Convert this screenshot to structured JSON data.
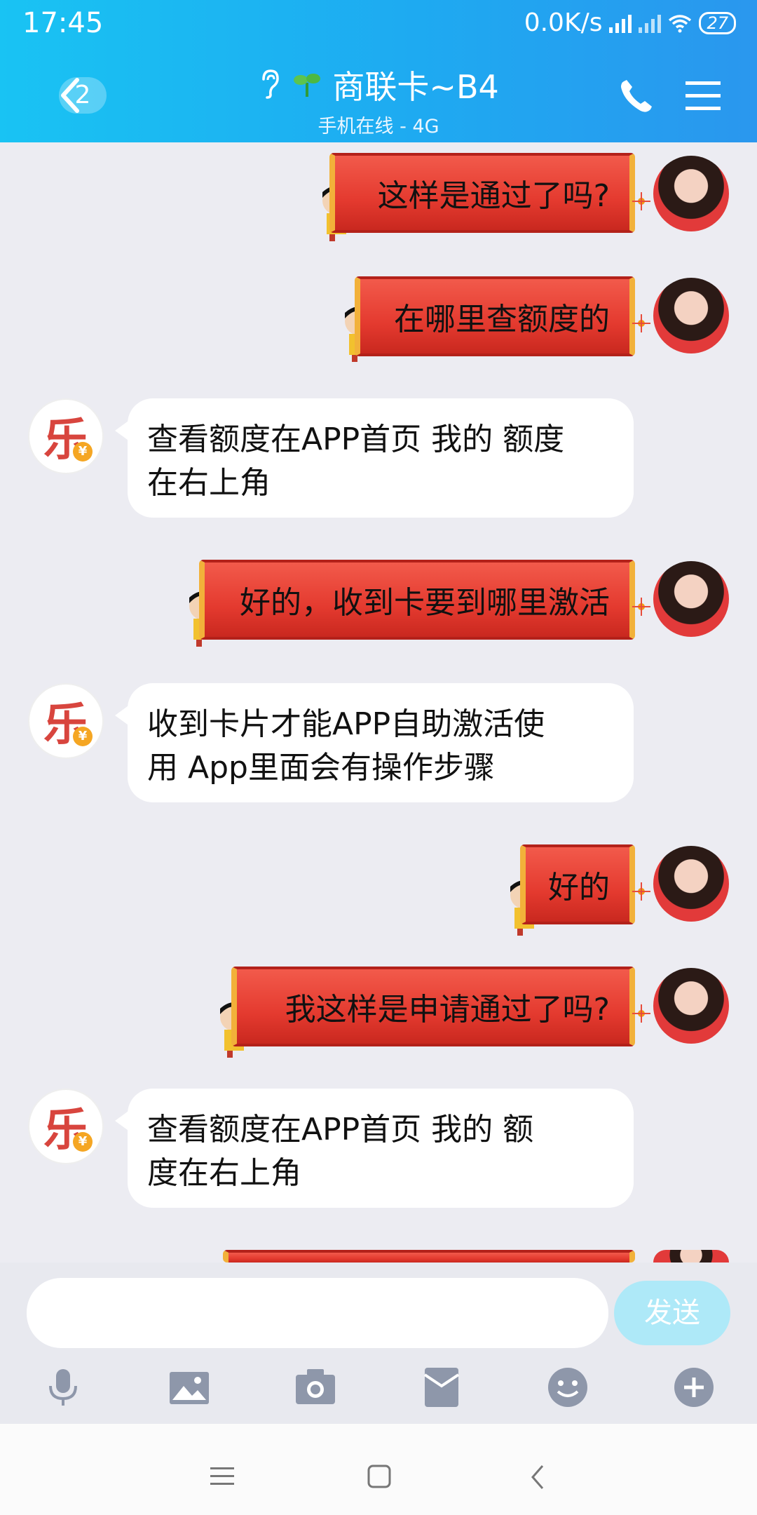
{
  "status": {
    "time": "17:45",
    "speed": "0.0K/s",
    "battery": "27"
  },
  "header": {
    "back_badge": "2",
    "title": "商联卡~B4",
    "subtitle": "手机在线 - 4G"
  },
  "messages": [
    {
      "side": "right",
      "text": "这样是通过了吗?"
    },
    {
      "side": "right",
      "text": "在哪里查额度的"
    },
    {
      "side": "left",
      "line1": "查看额度在APP首页 我的  额度",
      "line2": "在右上角"
    },
    {
      "side": "right",
      "text": "好的，收到卡要到哪里激活"
    },
    {
      "side": "left",
      "line1": " 收到卡片才能APP自助激活使",
      "line2": "用 App里面会有操作步骤"
    },
    {
      "side": "right",
      "text": "好的"
    },
    {
      "side": "right",
      "text": "我这样是申请通过了吗?"
    },
    {
      "side": "left",
      "line1": " 查看额度在APP首页 我的  额",
      "line2": "度在右上角"
    }
  ],
  "avatar_them": {
    "glyph": "乐",
    "badge": "¥"
  },
  "input": {
    "placeholder": "",
    "send_label": "发送"
  },
  "toolbar": [
    "microphone-icon",
    "image-icon",
    "camera-icon",
    "red-packet-icon",
    "emoji-icon",
    "plus-icon"
  ],
  "colors": {
    "header_start": "#19c3f3",
    "header_end": "#2a97ee",
    "bubble_red": "#e43a2f",
    "send_disabled": "#aee9f8"
  }
}
